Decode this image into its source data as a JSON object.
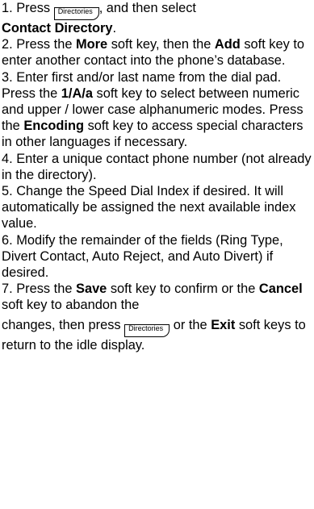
{
  "steps": [
    {
      "s1_a": "1. Press ",
      "s1_btn": "Directories",
      "s1_b": ", and then select ",
      "s1_bold": "Contact Directory",
      "s1_c": "."
    },
    {
      "a": "2. Press the ",
      "b1": "More",
      "b": " soft key, then the ",
      "b2": "Add",
      "c": " soft key to enter another contact into the phone’s database."
    },
    {
      "a": "3. Enter first and/or last name from the dial pad. Press the ",
      "b1": "1/A/a",
      "b": " soft key to select between numeric and upper / lower case alphanumeric modes. Press the ",
      "b2": "Encoding",
      "c": " soft key to access special characters in other languages if necessary."
    },
    {
      "text": "4. Enter a unique contact phone number (not already in the directory)."
    },
    {
      "text": "5. Change the Speed Dial Index if desired. It will automatically be assigned the next available index value."
    },
    {
      "text": "6. Modify the remainder of the fields (Ring Type, Divert Contact, Auto Reject, and Auto Divert) if desired."
    },
    {
      "a": "7. Press the ",
      "b1": "Save",
      "b": " soft key to confirm or the ",
      "b2": "Cancel",
      "c": " soft key to abandon the",
      "d": "changes, then press ",
      "btn": "Directories",
      "e": " or the ",
      "b3": "Exit",
      "f": " soft keys to return to the idle display."
    }
  ]
}
